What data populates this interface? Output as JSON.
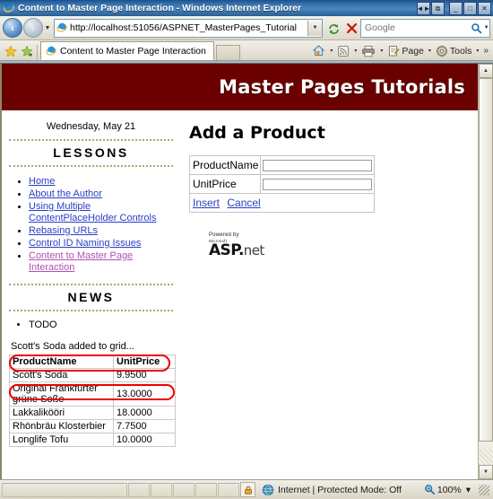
{
  "window": {
    "title": "Content to Master Page Interaction - Windows Internet Explorer",
    "buttons": {
      "restore_small": "◄►",
      "restore": "⧉",
      "minimize": "_",
      "maximize": "□",
      "close": "✕"
    }
  },
  "navbar": {
    "back_label": "Back",
    "forward_label": "Forward",
    "history_caret": "▼",
    "address_value": "http://localhost:51056/ASPNET_MasterPages_Tutorial",
    "address_caret": "▼",
    "refresh_label": "Refresh",
    "stop_label": "Stop",
    "search_placeholder": "Google",
    "search_value": "",
    "search_caret": "▼"
  },
  "tabbar": {
    "tab_label": "Content to Master Page Interaction",
    "commands": [
      {
        "name": "home",
        "label": ""
      },
      {
        "name": "feeds",
        "label": ""
      },
      {
        "name": "print",
        "label": ""
      },
      {
        "name": "page",
        "label": "Page"
      },
      {
        "name": "tools",
        "label": "Tools"
      }
    ],
    "more_chevron": "»"
  },
  "page": {
    "banner_title": "Master Pages Tutorials",
    "banner_color": "#6b0000",
    "sidebar": {
      "date": "Wednesday, May 21",
      "lessons_heading": "LESSONS",
      "lessons": [
        {
          "label": "Home",
          "visited": false
        },
        {
          "label": "About the Author",
          "visited": false
        },
        {
          "label": "Using Multiple ContentPlaceHolder Controls",
          "visited": false
        },
        {
          "label": "Rebasing URLs",
          "visited": false
        },
        {
          "label": "Control ID Naming Issues",
          "visited": false
        },
        {
          "label": "Content to Master Page Interaction",
          "visited": true
        }
      ],
      "news_heading": "NEWS",
      "news": [
        "TODO"
      ],
      "status_message": "Scott's Soda added to grid...",
      "grid": {
        "columns": [
          "ProductName",
          "UnitPrice"
        ],
        "rows": [
          {
            "ProductName": "Scott's Soda",
            "UnitPrice": "9.9500",
            "highlighted": true
          },
          {
            "ProductName": "Original Frankfurter grüne Soße",
            "UnitPrice": "13.0000",
            "highlighted": false
          },
          {
            "ProductName": "Lakkalikööri",
            "UnitPrice": "18.0000",
            "highlighted": false
          },
          {
            "ProductName": "Rhönbräu Klosterbier",
            "UnitPrice": "7.7500",
            "highlighted": false
          },
          {
            "ProductName": "Longlife Tofu",
            "UnitPrice": "10.0000",
            "highlighted": false
          }
        ]
      }
    },
    "main": {
      "heading": "Add a Product",
      "fields": [
        {
          "label": "ProductName",
          "value": "",
          "placeholder": ""
        },
        {
          "label": "UnitPrice",
          "value": "",
          "placeholder": ""
        }
      ],
      "insert_link": "Insert",
      "cancel_link": "Cancel",
      "logo": {
        "powered_by": "Powered by",
        "microsoft": "Microsoft",
        "asp": "ASP.",
        "net": "net"
      }
    },
    "annotation_color": "#ee0000"
  },
  "statusbar": {
    "zone_text": "Internet | Protected Mode: Off",
    "zoom_level": "100%",
    "zoom_caret": "▼"
  }
}
